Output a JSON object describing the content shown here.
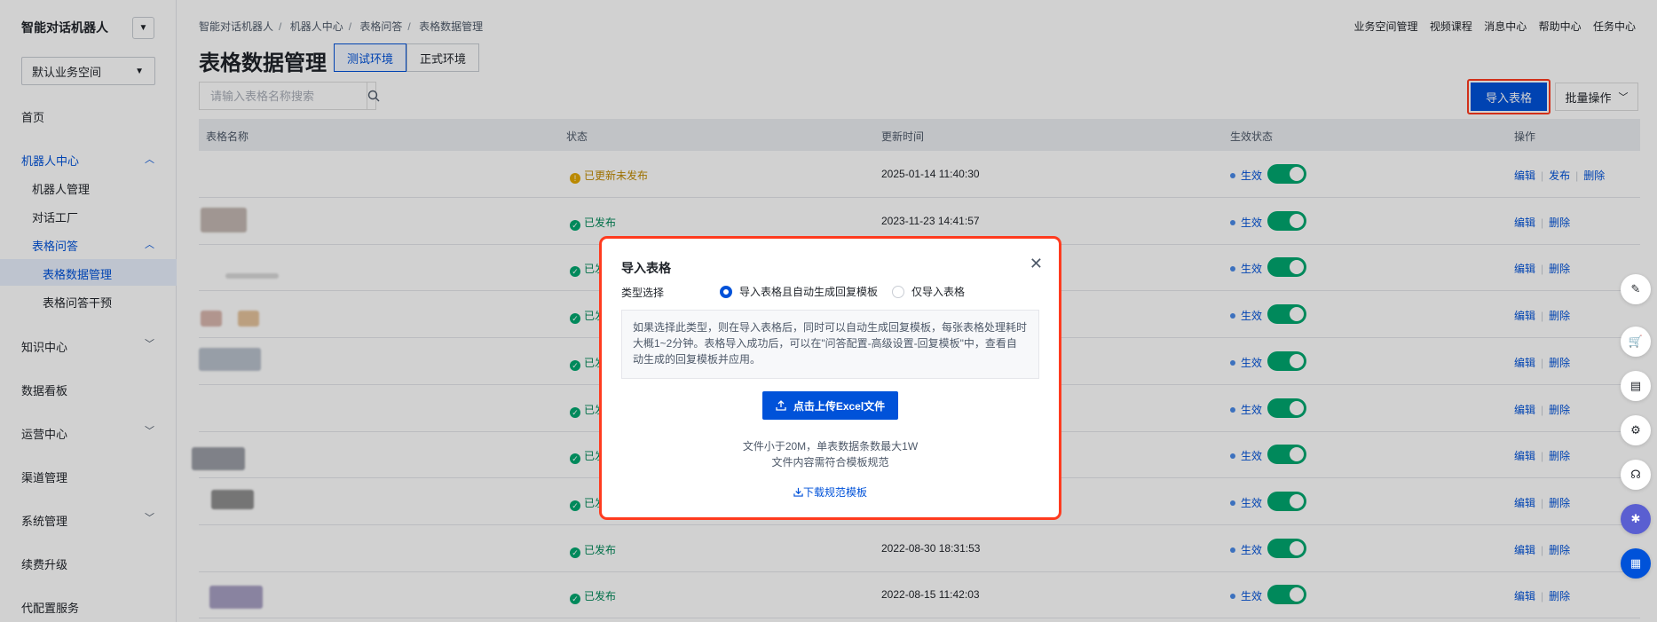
{
  "sidebar": {
    "brand": "智能对话机器人",
    "workspace": "默认业务空间",
    "items": [
      {
        "label": "首页"
      },
      {
        "label": "机器人中心"
      },
      {
        "label": "机器人管理"
      },
      {
        "label": "对话工厂"
      },
      {
        "label": "表格问答"
      },
      {
        "label": "表格数据管理"
      },
      {
        "label": "表格问答干预"
      },
      {
        "label": "知识中心"
      },
      {
        "label": "数据看板"
      },
      {
        "label": "运营中心"
      },
      {
        "label": "渠道管理"
      },
      {
        "label": "系统管理"
      },
      {
        "label": "续费升级"
      },
      {
        "label": "代配置服务"
      }
    ]
  },
  "header": {
    "breadcrumb": [
      "智能对话机器人",
      "机器人中心",
      "表格问答",
      "表格数据管理"
    ],
    "topnav": [
      "业务空间管理",
      "视频课程",
      "消息中心",
      "帮助中心",
      "任务中心"
    ],
    "title": "表格数据管理",
    "env_tabs": [
      "测试环境",
      "正式环境"
    ]
  },
  "toolbar": {
    "search_placeholder": "请输入表格名称搜索",
    "import_label": "导入表格",
    "batch_label": "批量操作"
  },
  "table": {
    "columns": [
      "表格名称",
      "状态",
      "更新时间",
      "生效状态",
      "操作"
    ],
    "rows": [
      {
        "status": "已更新未发布",
        "status_type": "updated",
        "time": "2025-01-14 11:40:30",
        "effect": "生效",
        "enabled": true,
        "ops": [
          "编辑",
          "发布",
          "删除"
        ]
      },
      {
        "status": "已发布",
        "status_type": "published",
        "time": "2023-11-23 14:41:57",
        "effect": "生效",
        "enabled": true,
        "ops": [
          "编辑",
          "删除"
        ]
      },
      {
        "status": "已发",
        "status_type": "published",
        "time": "",
        "effect": "生效",
        "enabled": true,
        "ops": [
          "编辑",
          "删除"
        ]
      },
      {
        "status": "已发",
        "status_type": "published",
        "time": "",
        "effect": "生效",
        "enabled": true,
        "ops": [
          "编辑",
          "删除"
        ]
      },
      {
        "status": "已发",
        "status_type": "published",
        "time": "",
        "effect": "生效",
        "enabled": true,
        "ops": [
          "编辑",
          "删除"
        ]
      },
      {
        "status": "已发",
        "status_type": "published",
        "time": "",
        "effect": "生效",
        "enabled": true,
        "ops": [
          "编辑",
          "删除"
        ]
      },
      {
        "status": "已发",
        "status_type": "published",
        "time": "",
        "effect": "生效",
        "enabled": true,
        "ops": [
          "编辑",
          "删除"
        ]
      },
      {
        "status": "已发",
        "status_type": "published",
        "time": "",
        "effect": "生效",
        "enabled": true,
        "ops": [
          "编辑",
          "删除"
        ]
      },
      {
        "status": "已发布",
        "status_type": "published",
        "time": "2022-08-30 18:31:53",
        "effect": "生效",
        "enabled": true,
        "ops": [
          "编辑",
          "删除"
        ]
      },
      {
        "status": "已发布",
        "status_type": "published",
        "time": "2022-08-15 11:42:03",
        "effect": "生效",
        "enabled": true,
        "ops": [
          "编辑",
          "删除"
        ]
      }
    ]
  },
  "modal": {
    "title": "导入表格",
    "type_label": "类型选择",
    "options": [
      "导入表格且自动生成回复模板",
      "仅导入表格"
    ],
    "selected_option": "导入表格且自动生成回复模板",
    "info_lines": [
      "如果选择此类型，则在导入表格后，同时可以自动生成回复模板，每张表格处理耗时",
      "大概1~2分钟。表格导入成功后，可以在\"问答配置-高级设置-回复模板\"中，查看自",
      "动生成的回复模板并应用。"
    ],
    "upload_label": "点击上传Excel文件",
    "hint_size": "文件小于20M，单表数据条数最大1W",
    "hint_format": "文件内容需符合模板规范",
    "download_label": "下载规范模板"
  },
  "colors": {
    "primary": "#0052d9",
    "success": "#00a870",
    "warning": "#e3a800",
    "highlight": "#ff3b1f"
  }
}
